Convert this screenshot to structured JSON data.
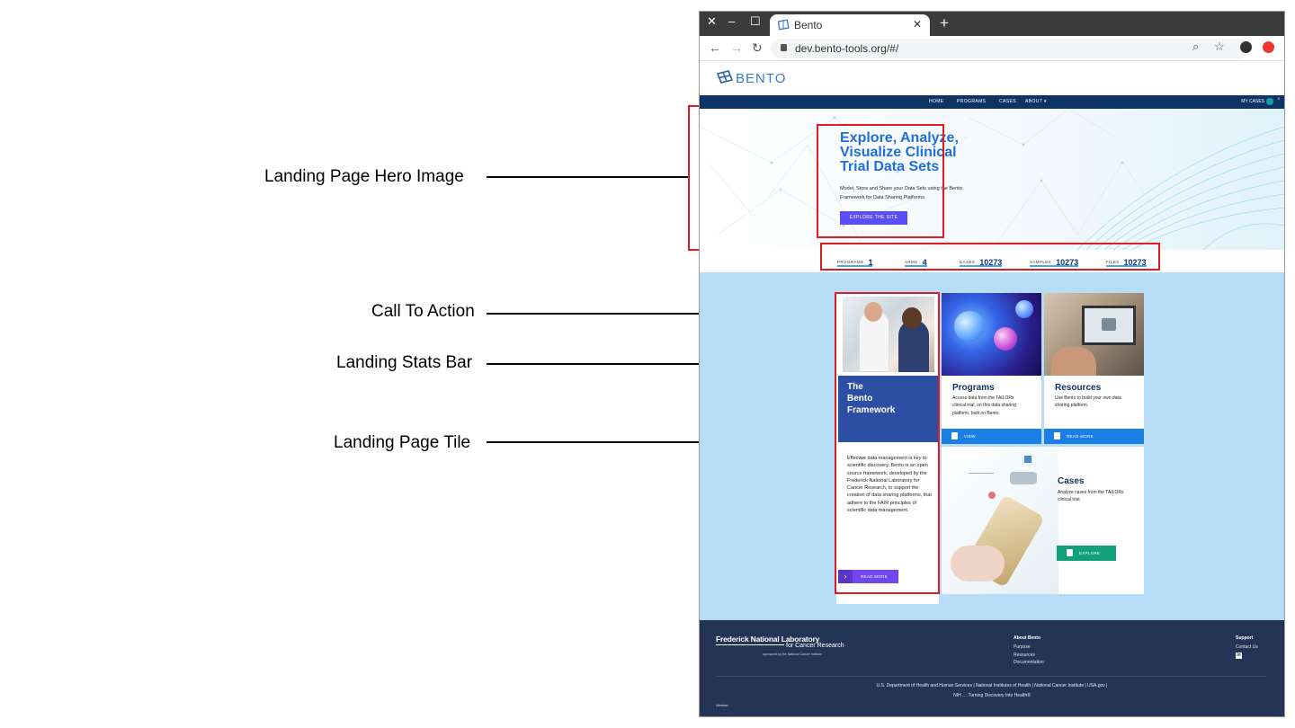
{
  "annotations": {
    "hero_image": "Landing Page Hero Image",
    "call_to_action": "Call To Action",
    "stats_bar": "Landing Stats Bar",
    "page_tile": "Landing Page Tile"
  },
  "browser": {
    "tab_title": "Bento",
    "url": "dev.bento-tools.org/#/",
    "new_tab": "+",
    "close_tab": "✕",
    "window_close": "✕",
    "window_min": "–",
    "window_max": "☐"
  },
  "site": {
    "logo_text": "BENTO",
    "nav": [
      "HOME",
      "PROGRAMS",
      "CASES",
      "ABOUT ▾"
    ],
    "my_cases": "MY CASES",
    "my_cases_count": "0"
  },
  "hero": {
    "title": "Explore, Analyze, Visualize Clinical Trial Data Sets",
    "subtitle": "Model, Store and Share your Data Sets using the Bento Framework for Data Sharing Platforms.",
    "button": "EXPLORE THE SITE"
  },
  "stats": [
    {
      "label": "PROGRAMS",
      "value": "1"
    },
    {
      "label": "ARMS",
      "value": "4"
    },
    {
      "label": "CASES",
      "value": "10273"
    },
    {
      "label": "SAMPLES",
      "value": "10273"
    },
    {
      "label": "FILES",
      "value": "10273"
    }
  ],
  "tiles": {
    "framework": {
      "title": "The Bento Framework",
      "title_lines": [
        "The",
        "Bento",
        "Framework"
      ],
      "description": "Effective data management is key to scientific discovery. Bento is an open source framework, developed by the Frederick National Laboratory for Cancer Research, to support the creation of data sharing platforms, that adhere to the FAIR principles of scientific data management.",
      "button": "READ MORE"
    },
    "programs": {
      "title": "Programs",
      "description": "Access data from the TAILORx clinical trial, on this data sharing platform, built on Bento.",
      "button": "VIEW"
    },
    "resources": {
      "title": "Resources",
      "description": "Use Bento to build your own data sharing platform.",
      "button": "READ MORE"
    },
    "cases": {
      "title": "Cases",
      "description": "Analyze cases from the TAILORx clinical trial.",
      "button": "EXPLORE"
    }
  },
  "footer": {
    "org_line1": "Frederick National Laboratory",
    "org_line2": "for Cancer Research",
    "org_line3": "sponsored by the National Cancer Institute",
    "about_heading": "About Bento",
    "about_links": [
      "Purpose",
      "Resources",
      "Documentation"
    ],
    "support_heading": "Support",
    "support_links": [
      "Contact Us"
    ],
    "gov_links": "U.S. Department of Health and Human Services | National Institutes of Health | National Cancer Institute | USA.gov |",
    "tagline": "NIH … Turning Discovery Into Health®",
    "version": "Version:"
  },
  "colors": {
    "nav_bg": "#0e3466",
    "hero_title": "#1e6fd9",
    "cta_button": "#5a4ff5",
    "page_bg": "#b7dcf8",
    "tile_blue": "#1a7ee3",
    "tile_green": "#10a07a",
    "framework_tile": "#2c4ea3",
    "footer_bg": "#243456",
    "annotation_red": "#e01b24"
  }
}
